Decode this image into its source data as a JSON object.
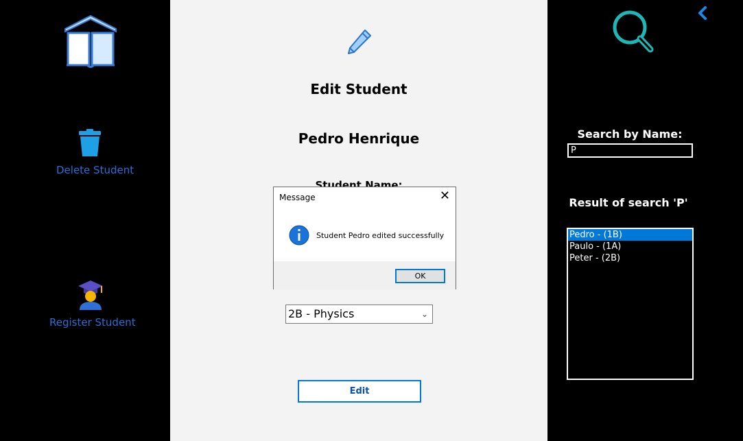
{
  "sidebar": {
    "delete_label": "Delete Student",
    "register_label": "Register Student"
  },
  "form": {
    "title": "Edit Student",
    "student_display_name": "Pedro Henrique",
    "name_label": "Student Name:",
    "class_select_value": "2B - Physics",
    "edit_button": "Edit"
  },
  "search": {
    "label": "Search by Name:",
    "value": "P",
    "results_heading": "Result of search 'P'",
    "results": [
      {
        "label": "Pedro - (1B)",
        "selected": true
      },
      {
        "label": "Paulo - (1A)",
        "selected": false
      },
      {
        "label": "Peter - (2B)",
        "selected": false
      }
    ]
  },
  "dialog": {
    "title": "Message",
    "message": "Student Pedro edited successfully",
    "ok_label": "OK"
  },
  "colors": {
    "accent": "#0078d7",
    "link": "#2b6fd6",
    "search_icon": "#1fb6b6",
    "back_icon": "#1e88e5"
  }
}
